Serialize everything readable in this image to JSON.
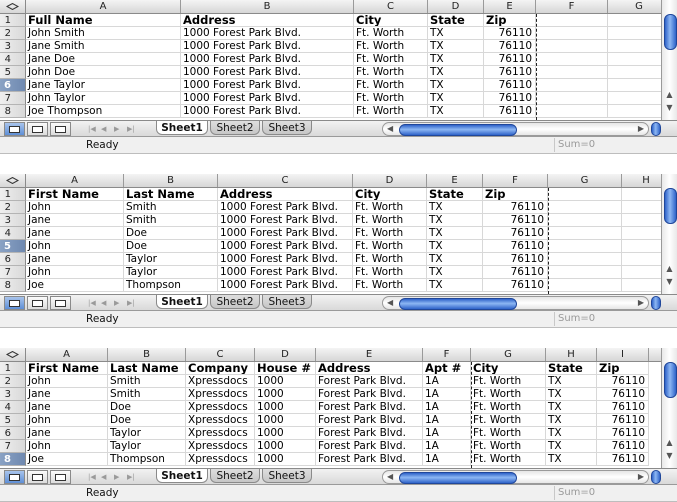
{
  "panels": [
    {
      "columns": [
        "A",
        "B",
        "C",
        "D",
        "E",
        "F",
        "G"
      ],
      "rows": [
        "1",
        "2",
        "3",
        "4",
        "5",
        "6",
        "7",
        "8"
      ],
      "selected_row": "6",
      "cells": [
        [
          "Full Name",
          "Address",
          "City",
          "State",
          "Zip",
          "",
          ""
        ],
        [
          "John Smith",
          "1000 Forest Park Blvd.",
          "Ft. Worth",
          "TX",
          "76110",
          "",
          ""
        ],
        [
          "Jane Smith",
          "1000 Forest Park Blvd.",
          "Ft. Worth",
          "TX",
          "76110",
          "",
          ""
        ],
        [
          "Jane Doe",
          "1000 Forest Park Blvd.",
          "Ft. Worth",
          "TX",
          "76110",
          "",
          ""
        ],
        [
          "John Doe",
          "1000 Forest Park Blvd.",
          "Ft. Worth",
          "TX",
          "76110",
          "",
          ""
        ],
        [
          "Jane Taylor",
          "1000 Forest Park Blvd.",
          "Ft. Worth",
          "TX",
          "76110",
          "",
          ""
        ],
        [
          "John Taylor",
          "1000 Forest Park Blvd.",
          "Ft. Worth",
          "TX",
          "76110",
          "",
          ""
        ],
        [
          "Joe Thompson",
          "1000 Forest Park Blvd.",
          "Ft. Worth",
          "TX",
          "76110",
          "",
          ""
        ]
      ],
      "sheet_tabs": [
        "Sheet1",
        "Sheet2",
        "Sheet3"
      ],
      "active_tab": "Sheet1",
      "status": "Ready",
      "sum": "Sum=0"
    },
    {
      "columns": [
        "A",
        "B",
        "C",
        "D",
        "E",
        "F",
        "G",
        "H"
      ],
      "rows": [
        "1",
        "2",
        "3",
        "4",
        "5",
        "6",
        "7",
        "8"
      ],
      "selected_row": "5",
      "cells": [
        [
          "First Name",
          "Last Name",
          "Address",
          "City",
          "State",
          "Zip",
          "",
          ""
        ],
        [
          "John",
          "Smith",
          "1000 Forest Park Blvd.",
          "Ft. Worth",
          "TX",
          "76110",
          "",
          ""
        ],
        [
          "Jane",
          "Smith",
          "1000 Forest Park Blvd.",
          "Ft. Worth",
          "TX",
          "76110",
          "",
          ""
        ],
        [
          "Jane",
          "Doe",
          "1000 Forest Park Blvd.",
          "Ft. Worth",
          "TX",
          "76110",
          "",
          ""
        ],
        [
          "John",
          "Doe",
          "1000 Forest Park Blvd.",
          "Ft. Worth",
          "TX",
          "76110",
          "",
          ""
        ],
        [
          "Jane",
          "Taylor",
          "1000 Forest Park Blvd.",
          "Ft. Worth",
          "TX",
          "76110",
          "",
          ""
        ],
        [
          "John",
          "Taylor",
          "1000 Forest Park Blvd.",
          "Ft. Worth",
          "TX",
          "76110",
          "",
          ""
        ],
        [
          "Joe",
          "Thompson",
          "1000 Forest Park Blvd.",
          "Ft. Worth",
          "TX",
          "76110",
          "",
          ""
        ]
      ],
      "sheet_tabs": [
        "Sheet1",
        "Sheet2",
        "Sheet3"
      ],
      "active_tab": "Sheet1",
      "status": "Ready",
      "sum": "Sum=0"
    },
    {
      "columns": [
        "A",
        "B",
        "C",
        "D",
        "E",
        "F",
        "G",
        "H",
        "I"
      ],
      "rows": [
        "1",
        "2",
        "3",
        "4",
        "5",
        "6",
        "7",
        "8"
      ],
      "selected_row": "8",
      "cells": [
        [
          "First Name",
          "Last Name",
          "Company",
          "House #",
          "Address",
          "Apt #",
          "City",
          "State",
          "Zip"
        ],
        [
          "John",
          "Smith",
          "Xpressdocs",
          "1000",
          "Forest Park Blvd.",
          "1A",
          "Ft. Worth",
          "TX",
          "76110"
        ],
        [
          "Jane",
          "Smith",
          "Xpressdocs",
          "1000",
          "Forest Park Blvd.",
          "1A",
          "Ft. Worth",
          "TX",
          "76110"
        ],
        [
          "Jane",
          "Doe",
          "Xpressdocs",
          "1000",
          "Forest Park Blvd.",
          "1A",
          "Ft. Worth",
          "TX",
          "76110"
        ],
        [
          "John",
          "Doe",
          "Xpressdocs",
          "1000",
          "Forest Park Blvd.",
          "1A",
          "Ft. Worth",
          "TX",
          "76110"
        ],
        [
          "Jane",
          "Taylor",
          "Xpressdocs",
          "1000",
          "Forest Park Blvd.",
          "1A",
          "Ft. Worth",
          "TX",
          "76110"
        ],
        [
          "John",
          "Taylor",
          "Xpressdocs",
          "1000",
          "Forest Park Blvd.",
          "1A",
          "Ft. Worth",
          "TX",
          "76110"
        ],
        [
          "Joe",
          "Thompson",
          "Xpressdocs",
          "1000",
          "Forest Park Blvd.",
          "1A",
          "Ft. Worth",
          "TX",
          "76110"
        ]
      ],
      "sheet_tabs": [
        "Sheet1",
        "Sheet2",
        "Sheet3"
      ],
      "active_tab": "Sheet1",
      "status": "Ready",
      "sum": "Sum=0"
    }
  ],
  "colors": {
    "selected_row_header": "#7f96bc",
    "scroll_thumb": "#3a6fd2",
    "gridline": "#d8d8d8"
  }
}
